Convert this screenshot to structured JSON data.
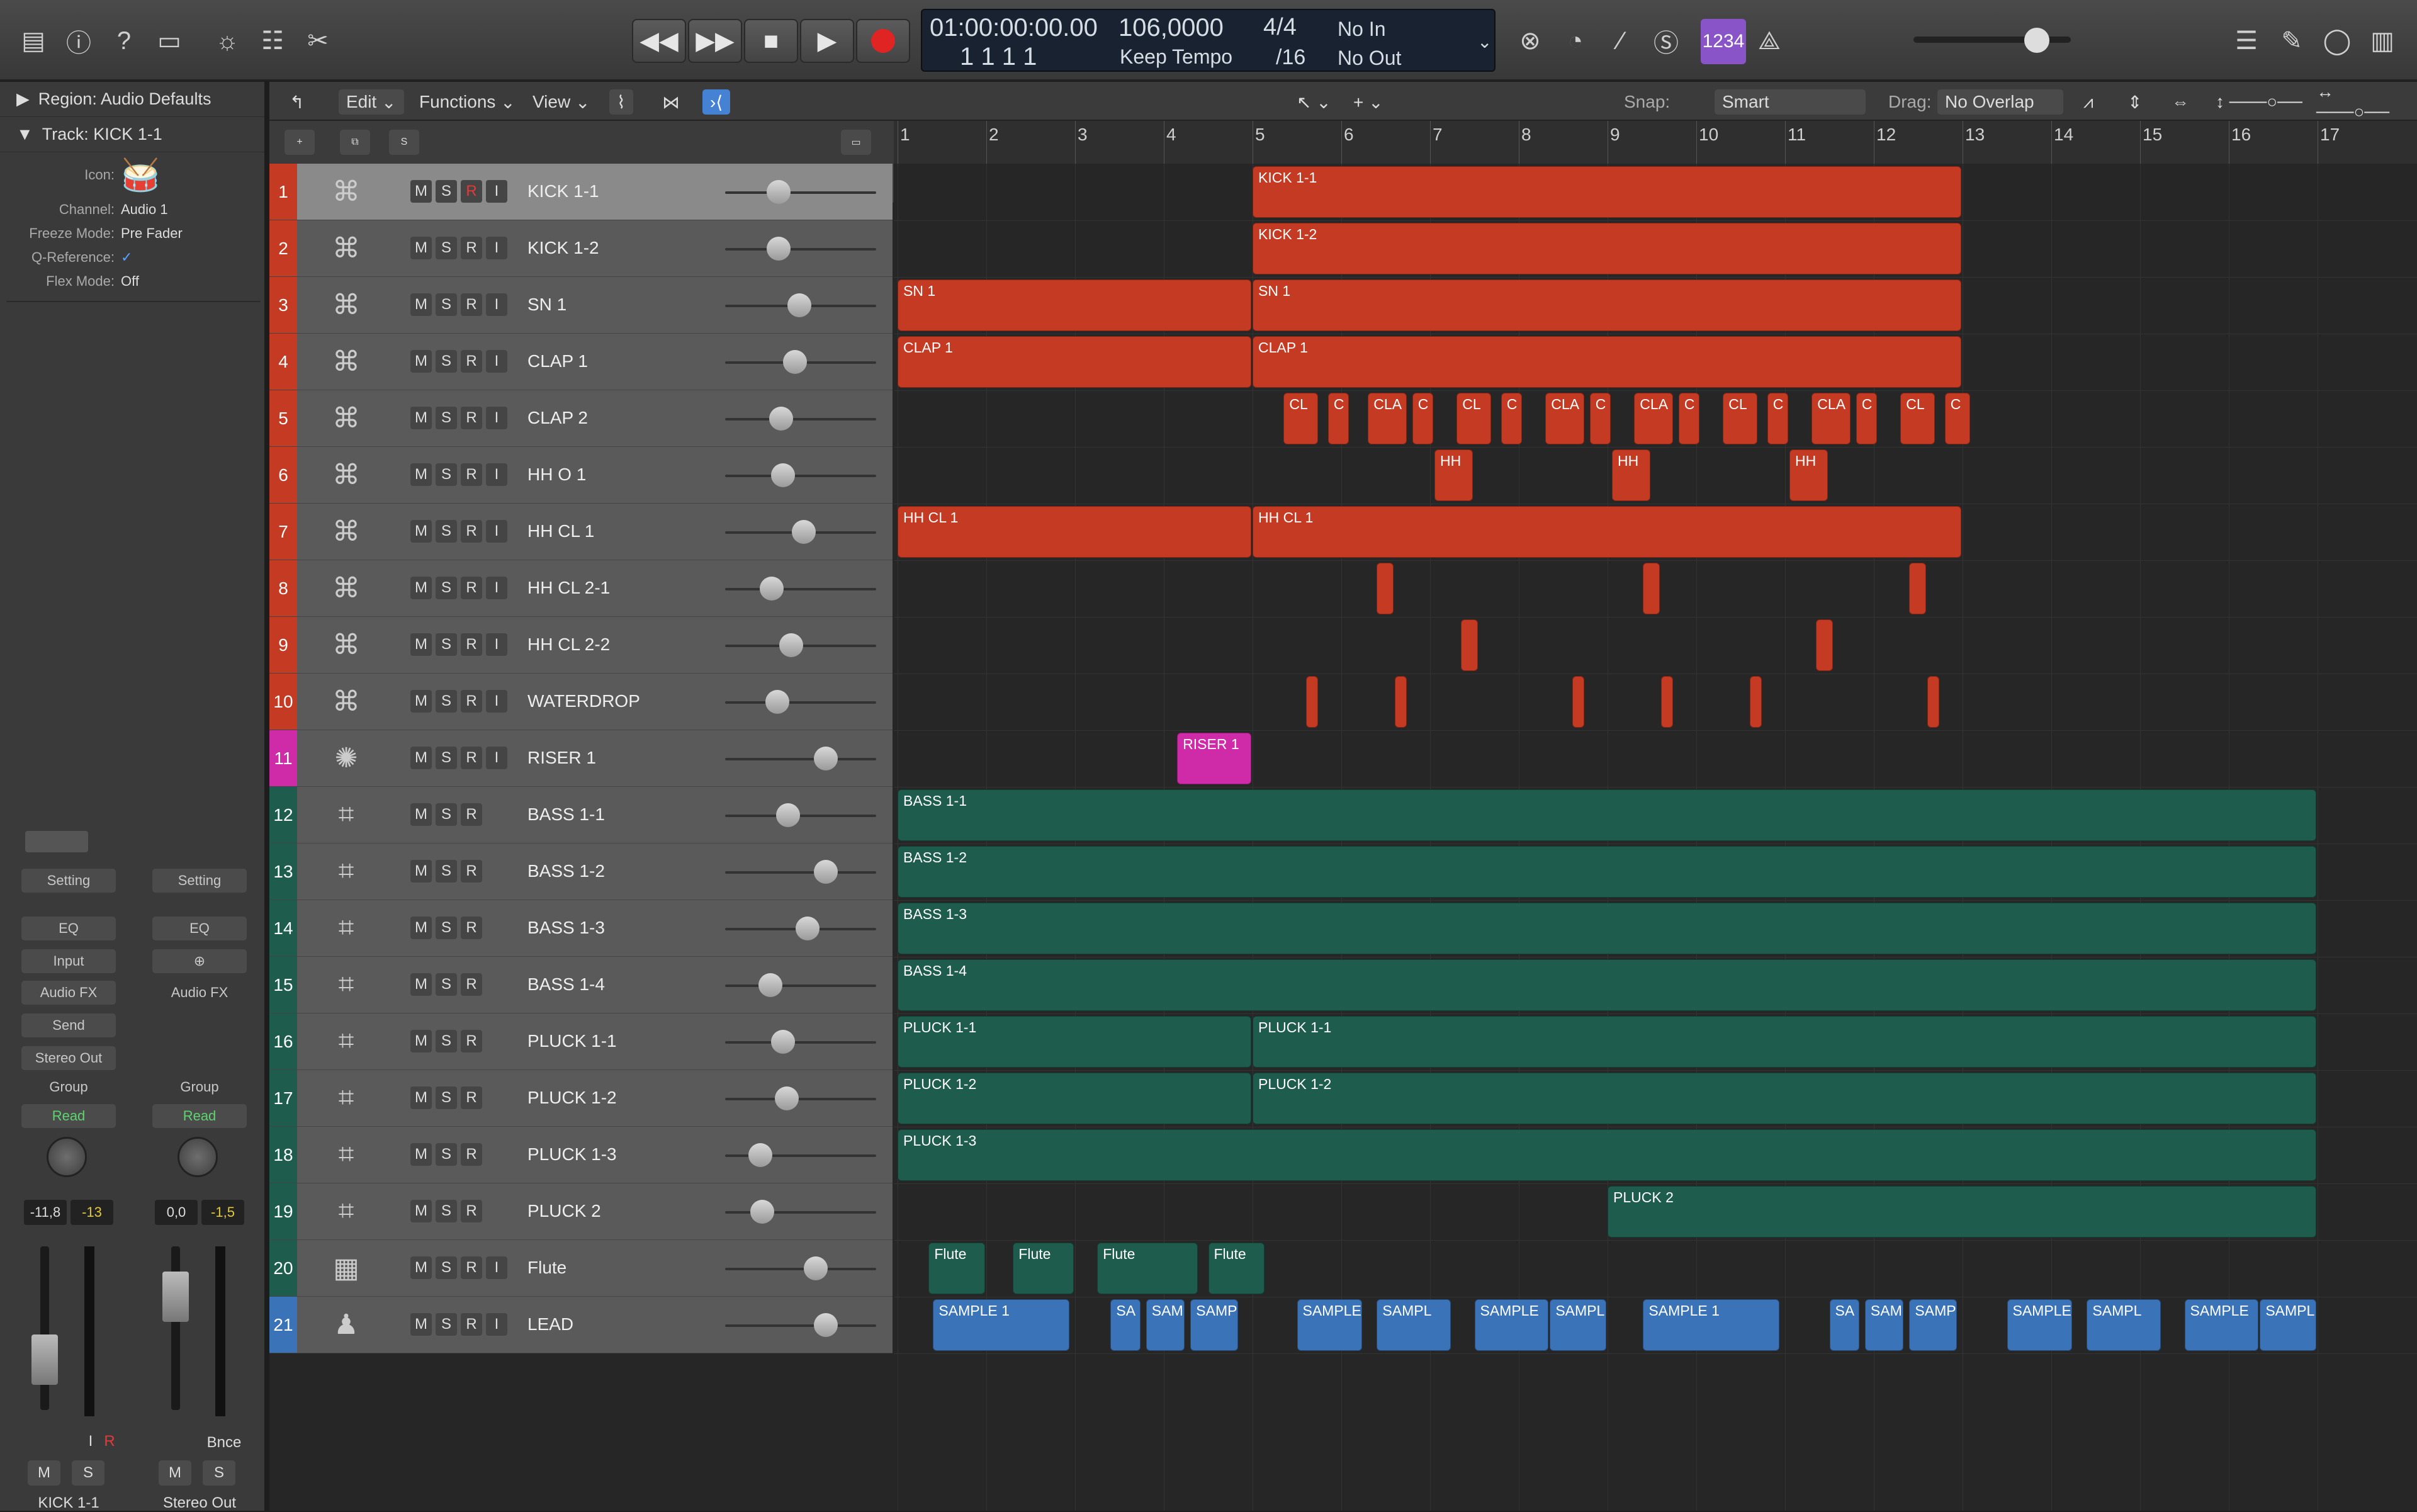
{
  "toolbar": {
    "lcd": {
      "time": "01:00:00:00.00",
      "bars": "1 1 1 1",
      "tempo": "106,0000",
      "tempo_mode": "Keep Tempo",
      "sig_top": "4/4",
      "sig_bottom": "/16",
      "in": "No In",
      "out": "No Out"
    },
    "purple_label": "1234"
  },
  "inspector": {
    "region_title": "Region: Audio Defaults",
    "track_title": "Track: KICK 1-1",
    "rows": [
      {
        "k": "Icon:",
        "v": ""
      },
      {
        "k": "Channel:",
        "v": "Audio 1"
      },
      {
        "k": "Freeze Mode:",
        "v": "Pre Fader"
      },
      {
        "k": "Q-Reference:",
        "v": "✓"
      },
      {
        "k": "Flex Mode:",
        "v": "Off"
      }
    ],
    "strip1": {
      "setting": "Setting",
      "eq": "EQ",
      "input": "Input",
      "audiofx": "Audio FX",
      "send": "Send",
      "output": "Stereo Out",
      "group": "Group",
      "read": "Read",
      "vol": "-11,8",
      "peak": "-13",
      "m": "M",
      "s": "S",
      "name": "KICK 1-1",
      "i": "I",
      "r": "R"
    },
    "strip2": {
      "setting": "Setting",
      "eq": "EQ",
      "audiofx": "Audio FX",
      "group": "Group",
      "read": "Read",
      "vol": "0,0",
      "peak": "-1,5",
      "m": "M",
      "s": "S",
      "name": "Stereo Out",
      "bnce": "Bnce"
    }
  },
  "localbar": {
    "edit": "Edit",
    "functions": "Functions",
    "view": "View",
    "snap_label": "Snap:",
    "snap": "Smart",
    "drag_label": "Drag:",
    "drag": "No Overlap"
  },
  "ruler": [
    "1",
    "2",
    "3",
    "4",
    "5",
    "6",
    "7",
    "8",
    "9",
    "10",
    "11",
    "12",
    "13",
    "14",
    "15",
    "16",
    "17"
  ],
  "tracks": [
    {
      "n": "1",
      "name": "KICK 1-1",
      "type": "drum",
      "color": "#c43a22",
      "vol": 0.3,
      "sel": true
    },
    {
      "n": "2",
      "name": "KICK 1-2",
      "type": "drum",
      "color": "#c43a22",
      "vol": 0.3
    },
    {
      "n": "3",
      "name": "SN 1",
      "type": "drum",
      "color": "#c43a22",
      "vol": 0.45
    },
    {
      "n": "4",
      "name": "CLAP 1",
      "type": "drum",
      "color": "#c43a22",
      "vol": 0.42
    },
    {
      "n": "5",
      "name": "CLAP 2",
      "type": "drum",
      "color": "#c43a22",
      "vol": 0.32
    },
    {
      "n": "6",
      "name": "HH O 1",
      "type": "drum",
      "color": "#c43a22",
      "vol": 0.33
    },
    {
      "n": "7",
      "name": "HH CL 1",
      "type": "drum",
      "color": "#c43a22",
      "vol": 0.48
    },
    {
      "n": "8",
      "name": "HH CL 2-1",
      "type": "drum",
      "color": "#c43a22",
      "vol": 0.25
    },
    {
      "n": "9",
      "name": "HH CL 2-2",
      "type": "drum",
      "color": "#c43a22",
      "vol": 0.39
    },
    {
      "n": "10",
      "name": "WATERDROP",
      "type": "drum",
      "color": "#c43a22",
      "vol": 0.29
    },
    {
      "n": "11",
      "name": "RISER 1",
      "type": "riser",
      "color": "#cf2aa8",
      "vol": 0.64
    },
    {
      "n": "12",
      "name": "BASS 1-1",
      "type": "synth",
      "color": "#1e5c4e",
      "vol": 0.37
    },
    {
      "n": "13",
      "name": "BASS 1-2",
      "type": "synth",
      "color": "#1e5c4e",
      "vol": 0.64
    },
    {
      "n": "14",
      "name": "BASS 1-3",
      "type": "synth",
      "color": "#1e5c4e",
      "vol": 0.51
    },
    {
      "n": "15",
      "name": "BASS 1-4",
      "type": "synth",
      "color": "#1e5c4e",
      "vol": 0.24
    },
    {
      "n": "16",
      "name": "PLUCK 1-1",
      "type": "synth",
      "color": "#1e5c4e",
      "vol": 0.33
    },
    {
      "n": "17",
      "name": "PLUCK 1-2",
      "type": "synth",
      "color": "#1e5c4e",
      "vol": 0.36
    },
    {
      "n": "18",
      "name": "PLUCK 1-3",
      "type": "synth",
      "color": "#1e5c4e",
      "vol": 0.17
    },
    {
      "n": "19",
      "name": "PLUCK 2",
      "type": "synth",
      "color": "#1e5c4e",
      "vol": 0.18
    },
    {
      "n": "20",
      "name": "Flute",
      "type": "keys",
      "color": "#1e5c4e",
      "vol": 0.57
    },
    {
      "n": "21",
      "name": "LEAD",
      "type": "lead",
      "color": "#3b73b9",
      "vol": 0.64
    }
  ],
  "regions": [
    {
      "t": 0,
      "s": 5,
      "e": 13,
      "l": "KICK 1-1",
      "c": "red"
    },
    {
      "t": 1,
      "s": 5,
      "e": 13,
      "l": "KICK 1-2",
      "c": "red"
    },
    {
      "t": 2,
      "s": 1,
      "e": 5,
      "l": "SN 1",
      "c": "red"
    },
    {
      "t": 2,
      "s": 5,
      "e": 13,
      "l": "SN 1",
      "c": "red"
    },
    {
      "t": 3,
      "s": 1,
      "e": 5,
      "l": "CLAP 1",
      "c": "red"
    },
    {
      "t": 3,
      "s": 5,
      "e": 13,
      "l": "CLAP 1",
      "c": "red"
    },
    {
      "t": 4,
      "s": 5.35,
      "e": 5.75,
      "l": "CL",
      "c": "red"
    },
    {
      "t": 4,
      "s": 5.85,
      "e": 6.1,
      "l": "C",
      "c": "red"
    },
    {
      "t": 4,
      "s": 6.3,
      "e": 6.75,
      "l": "CLA",
      "c": "red"
    },
    {
      "t": 4,
      "s": 6.8,
      "e": 7.05,
      "l": "C",
      "c": "red"
    },
    {
      "t": 4,
      "s": 7.3,
      "e": 7.7,
      "l": "CL",
      "c": "red"
    },
    {
      "t": 4,
      "s": 7.8,
      "e": 8.05,
      "l": "C",
      "c": "red"
    },
    {
      "t": 4,
      "s": 8.3,
      "e": 8.75,
      "l": "CLA",
      "c": "red"
    },
    {
      "t": 4,
      "s": 8.8,
      "e": 9.05,
      "l": "C",
      "c": "red"
    },
    {
      "t": 4,
      "s": 9.3,
      "e": 9.75,
      "l": "CLA",
      "c": "red"
    },
    {
      "t": 4,
      "s": 9.8,
      "e": 10.05,
      "l": "C",
      "c": "red"
    },
    {
      "t": 4,
      "s": 10.3,
      "e": 10.7,
      "l": "CL",
      "c": "red"
    },
    {
      "t": 4,
      "s": 10.8,
      "e": 11.05,
      "l": "C",
      "c": "red"
    },
    {
      "t": 4,
      "s": 11.3,
      "e": 11.75,
      "l": "CLA",
      "c": "red"
    },
    {
      "t": 4,
      "s": 11.8,
      "e": 12.05,
      "l": "C",
      "c": "red"
    },
    {
      "t": 4,
      "s": 12.3,
      "e": 12.7,
      "l": "CL",
      "c": "red"
    },
    {
      "t": 4,
      "s": 12.8,
      "e": 13.1,
      "l": "C",
      "c": "red"
    },
    {
      "t": 5,
      "s": 7.05,
      "e": 7.5,
      "l": "HH",
      "c": "red"
    },
    {
      "t": 5,
      "s": 9.05,
      "e": 9.5,
      "l": "HH",
      "c": "red"
    },
    {
      "t": 5,
      "s": 11.05,
      "e": 11.5,
      "l": "HH",
      "c": "red"
    },
    {
      "t": 6,
      "s": 1,
      "e": 5,
      "l": "HH CL 1",
      "c": "red"
    },
    {
      "t": 6,
      "s": 5,
      "e": 13,
      "l": "HH CL 1",
      "c": "red"
    },
    {
      "t": 7,
      "s": 6.4,
      "e": 6.6,
      "l": "",
      "c": "red"
    },
    {
      "t": 7,
      "s": 9.4,
      "e": 9.6,
      "l": "",
      "c": "red"
    },
    {
      "t": 7,
      "s": 12.4,
      "e": 12.6,
      "l": "",
      "c": "red"
    },
    {
      "t": 8,
      "s": 7.35,
      "e": 7.55,
      "l": "",
      "c": "red"
    },
    {
      "t": 8,
      "s": 11.35,
      "e": 11.55,
      "l": "",
      "c": "red"
    },
    {
      "t": 9,
      "s": 5.6,
      "e": 5.75,
      "l": "",
      "c": "red"
    },
    {
      "t": 9,
      "s": 6.6,
      "e": 6.75,
      "l": "",
      "c": "red"
    },
    {
      "t": 9,
      "s": 8.6,
      "e": 8.75,
      "l": "",
      "c": "red"
    },
    {
      "t": 9,
      "s": 9.6,
      "e": 9.75,
      "l": "",
      "c": "red"
    },
    {
      "t": 9,
      "s": 10.6,
      "e": 10.75,
      "l": "",
      "c": "red"
    },
    {
      "t": 9,
      "s": 12.6,
      "e": 12.75,
      "l": "",
      "c": "red"
    },
    {
      "t": 10,
      "s": 4.15,
      "e": 5,
      "l": "RISER 1",
      "c": "pink"
    },
    {
      "t": 11,
      "s": 1,
      "e": 17,
      "l": "BASS 1-1",
      "c": "green"
    },
    {
      "t": 12,
      "s": 1,
      "e": 17,
      "l": "BASS 1-2",
      "c": "green"
    },
    {
      "t": 13,
      "s": 1,
      "e": 17,
      "l": "BASS 1-3",
      "c": "green"
    },
    {
      "t": 14,
      "s": 1,
      "e": 17,
      "l": "BASS 1-4",
      "c": "green"
    },
    {
      "t": 15,
      "s": 1,
      "e": 5,
      "l": "PLUCK 1-1",
      "c": "green"
    },
    {
      "t": 15,
      "s": 5,
      "e": 17,
      "l": "PLUCK 1-1",
      "c": "green"
    },
    {
      "t": 16,
      "s": 1,
      "e": 5,
      "l": "PLUCK 1-2",
      "c": "green"
    },
    {
      "t": 16,
      "s": 5,
      "e": 17,
      "l": "PLUCK 1-2",
      "c": "green"
    },
    {
      "t": 17,
      "s": 1,
      "e": 17,
      "l": "PLUCK 1-3",
      "c": "green"
    },
    {
      "t": 18,
      "s": 9,
      "e": 17,
      "l": "PLUCK 2",
      "c": "green"
    },
    {
      "t": 19,
      "s": 1.35,
      "e": 2,
      "l": "Flute",
      "c": "green"
    },
    {
      "t": 19,
      "s": 2.3,
      "e": 3,
      "l": "Flute",
      "c": "green"
    },
    {
      "t": 19,
      "s": 3.25,
      "e": 4.4,
      "l": "Flute",
      "c": "green"
    },
    {
      "t": 19,
      "s": 4.5,
      "e": 5.15,
      "l": "Flute",
      "c": "green"
    },
    {
      "t": 20,
      "s": 1.4,
      "e": 2.95,
      "l": "SAMPLE 1",
      "c": "blue"
    },
    {
      "t": 20,
      "s": 3.4,
      "e": 3.75,
      "l": "SA",
      "c": "blue"
    },
    {
      "t": 20,
      "s": 3.8,
      "e": 4.25,
      "l": "SAM",
      "c": "blue"
    },
    {
      "t": 20,
      "s": 4.3,
      "e": 4.85,
      "l": "SAMP",
      "c": "blue"
    },
    {
      "t": 20,
      "s": 5.5,
      "e": 6.25,
      "l": "SAMPLE",
      "c": "blue"
    },
    {
      "t": 20,
      "s": 6.4,
      "e": 7.25,
      "l": "SAMPL",
      "c": "blue"
    },
    {
      "t": 20,
      "s": 7.5,
      "e": 8.35,
      "l": "SAMPLE",
      "c": "blue"
    },
    {
      "t": 20,
      "s": 8.35,
      "e": 9,
      "l": "SAMPL",
      "c": "blue"
    },
    {
      "t": 20,
      "s": 9.4,
      "e": 10.95,
      "l": "SAMPLE 1",
      "c": "blue"
    },
    {
      "t": 20,
      "s": 11.5,
      "e": 11.85,
      "l": "SA",
      "c": "blue"
    },
    {
      "t": 20,
      "s": 11.9,
      "e": 12.35,
      "l": "SAM",
      "c": "blue"
    },
    {
      "t": 20,
      "s": 12.4,
      "e": 12.95,
      "l": "SAMP",
      "c": "blue"
    },
    {
      "t": 20,
      "s": 13.5,
      "e": 14.25,
      "l": "SAMPLE",
      "c": "blue"
    },
    {
      "t": 20,
      "s": 14.4,
      "e": 15.25,
      "l": "SAMPL",
      "c": "blue"
    },
    {
      "t": 20,
      "s": 15.5,
      "e": 16.35,
      "l": "SAMPLE",
      "c": "blue"
    },
    {
      "t": 20,
      "s": 16.35,
      "e": 17,
      "l": "SAMPL",
      "c": "blue"
    }
  ]
}
